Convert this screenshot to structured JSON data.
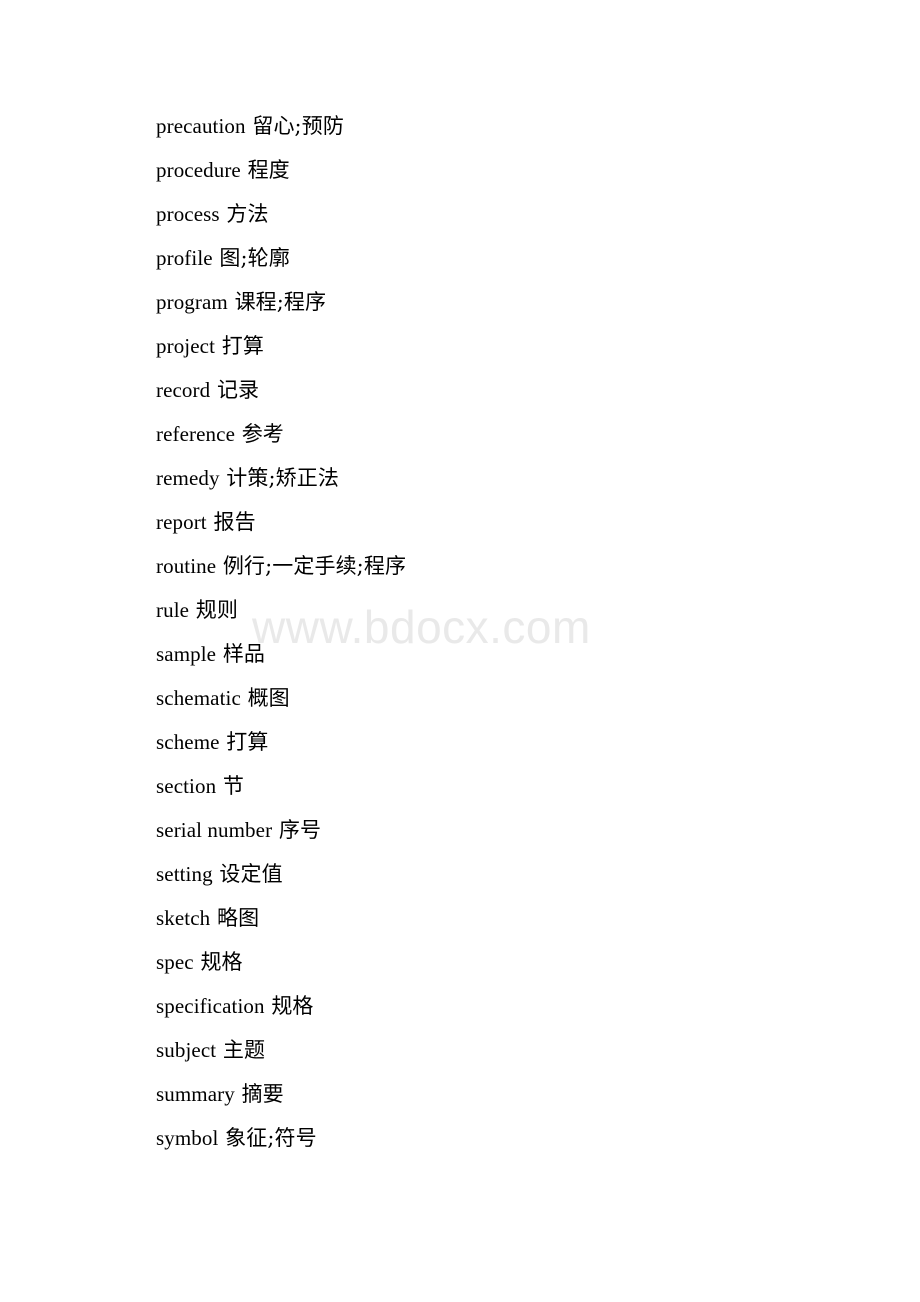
{
  "document": {
    "page_background": "#ffffff",
    "text_color": "#000000",
    "watermark": {
      "text": "www.bdocx.com",
      "color": "#e9e9e9"
    },
    "entries": [
      {
        "term": "precaution",
        "gloss": "留心;预防"
      },
      {
        "term": "procedure",
        "gloss": "程度"
      },
      {
        "term": "process",
        "gloss": "方法"
      },
      {
        "term": "profile",
        "gloss": "图;轮廓"
      },
      {
        "term": "program",
        "gloss": "课程;程序"
      },
      {
        "term": "project",
        "gloss": "打算"
      },
      {
        "term": "record",
        "gloss": "记录"
      },
      {
        "term": "reference",
        "gloss": "参考"
      },
      {
        "term": "remedy",
        "gloss": "计策;矫正法"
      },
      {
        "term": "report",
        "gloss": "报告"
      },
      {
        "term": "routine",
        "gloss": "例行;一定手续;程序"
      },
      {
        "term": "rule",
        "gloss": "规则"
      },
      {
        "term": "sample",
        "gloss": "样品"
      },
      {
        "term": "schematic",
        "gloss": "概图"
      },
      {
        "term": "scheme",
        "gloss": "打算"
      },
      {
        "term": "section",
        "gloss": "节"
      },
      {
        "term": "serial number",
        "gloss": "序号"
      },
      {
        "term": "setting",
        "gloss": "设定值"
      },
      {
        "term": "sketch",
        "gloss": "略图"
      },
      {
        "term": "spec",
        "gloss": "规格"
      },
      {
        "term": "specification",
        "gloss": "规格"
      },
      {
        "term": "subject",
        "gloss": "主题"
      },
      {
        "term": "summary",
        "gloss": "摘要"
      },
      {
        "term": "symbol",
        "gloss": "象征;符号"
      }
    ]
  }
}
